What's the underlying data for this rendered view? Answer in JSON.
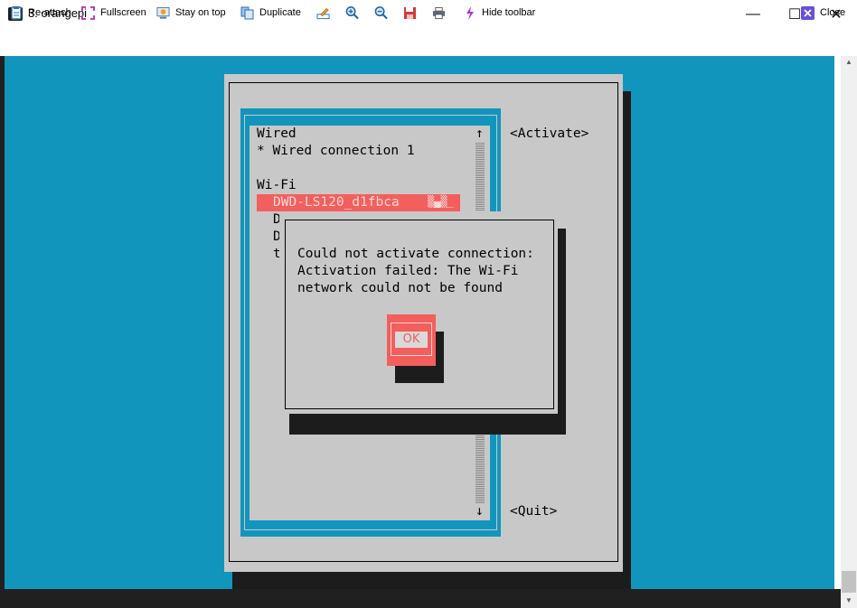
{
  "window": {
    "title": "3. orangepi",
    "minimize": "—",
    "maximize": "☐",
    "close": "✕"
  },
  "toolbar": {
    "reattach": "Re-attach",
    "fullscreen": "Fullscreen",
    "stay_on_top": "Stay on top",
    "duplicate": "Duplicate",
    "hide_toolbar": "Hide toolbar",
    "close": "Close",
    "icons": [
      "reattach-icon",
      "fullscreen-icon",
      "stay-on-top-icon",
      "duplicate-icon",
      "edit-icon",
      "zoom-in-icon",
      "zoom-out-icon",
      "save-icon",
      "print-icon",
      "hide-toolbar-icon",
      "close-icon"
    ]
  },
  "nmtui": {
    "list": {
      "wired_header": "Wired",
      "wired_item": "* Wired connection 1",
      "wifi_header": "Wi-Fi",
      "wifi_selected": "DWD-LS120_d1fbca",
      "wifi_selected_signal": "▒▄▒_",
      "partial_rows": [
        "D",
        "D",
        "t"
      ],
      "arrow_up": "↑",
      "arrow_down": "↓"
    },
    "buttons": {
      "activate": "<Activate>",
      "quit": "<Quit>"
    },
    "dialog": {
      "line1": "Could not activate connection:",
      "line2": "Activation failed: The Wi-Fi",
      "line3": "network could not be found",
      "ok": "OK"
    }
  },
  "colors": {
    "terminal_bg": "#1295bd",
    "panel": "#c8c8c8",
    "accent": "#f25f5c",
    "shadow": "#1c1c1c"
  }
}
